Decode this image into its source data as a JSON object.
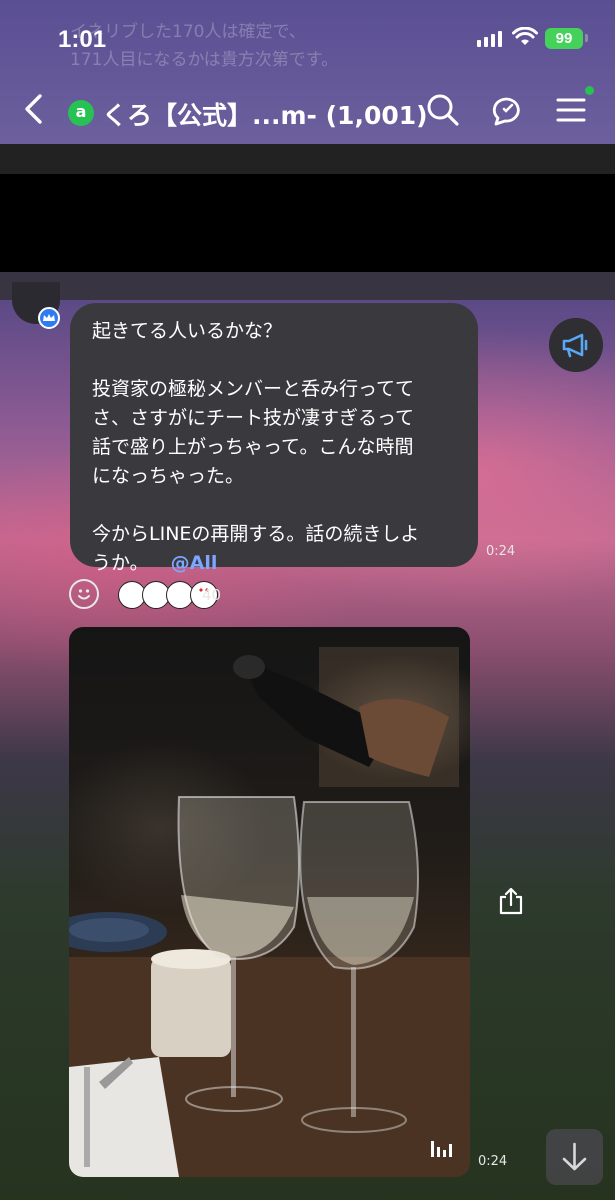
{
  "status": {
    "time": "1:01",
    "battery": "99",
    "ghost_line1": "イネリブした170人は確定で、",
    "ghost_line2": "171人目になるかは貴方次第です。"
  },
  "header": {
    "badge": "a",
    "title": "くろ【公式】...m- (1,001)"
  },
  "message": {
    "line1": "起きてる人いるかな？",
    "line2": "投資家の極秘メンバーと呑み行ってて",
    "line3": "さ、さすがにチート技が凄すぎるって",
    "line4": "話で盛り上がっちゃって。こんな時間",
    "line5": "になっちゃった。",
    "line6": "今からLINEの再開する。話の続きしよ",
    "line7": "うか。",
    "mention": "@All",
    "time": "0:24",
    "reaction_count": "40"
  },
  "video": {
    "time": "0:24"
  },
  "colors": {
    "bubble": "#3a3a3e",
    "mention": "#7ea6ff",
    "battery": "#44d25b",
    "badge": "#27c253"
  },
  "icons": [
    "back-chevron-icon",
    "search-icon",
    "chat-bubbles-icon",
    "menu-icon",
    "megaphone-icon",
    "smiley-icon",
    "share-icon",
    "chevron-down-icon",
    "audio-bars-icon"
  ]
}
